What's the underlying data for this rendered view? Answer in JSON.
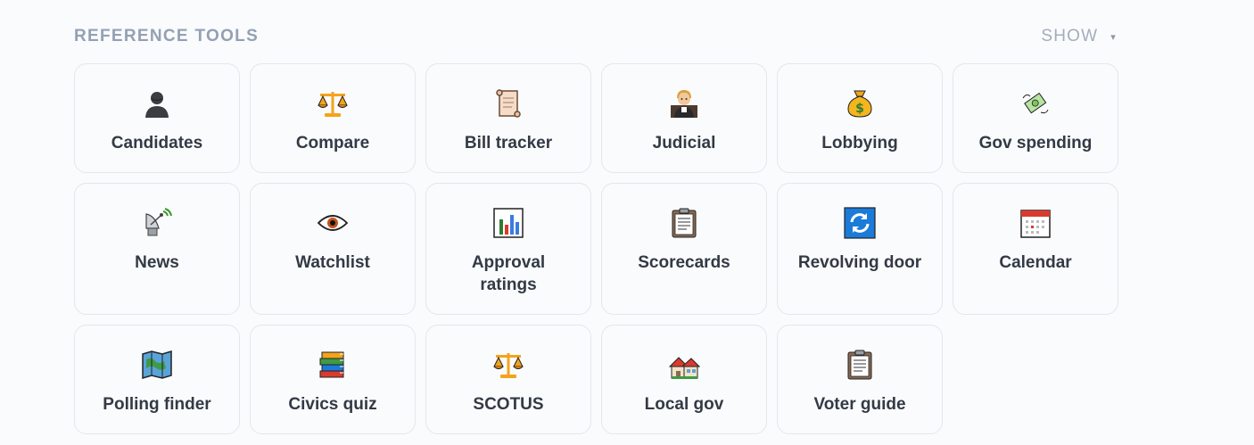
{
  "section": {
    "title": "REFERENCE TOOLS",
    "toggle_label": "SHOW",
    "toggle_caret": "▾"
  },
  "tools": [
    {
      "label": "Candidates",
      "icon": "person-silhouette-icon"
    },
    {
      "label": "Compare",
      "icon": "balance-scale-icon"
    },
    {
      "label": "Bill tracker",
      "icon": "scroll-icon"
    },
    {
      "label": "Judicial",
      "icon": "judge-icon"
    },
    {
      "label": "Lobbying",
      "icon": "money-bag-icon"
    },
    {
      "label": "Gov spending",
      "icon": "money-with-wings-icon"
    },
    {
      "label": "News",
      "icon": "satellite-antenna-icon"
    },
    {
      "label": "Watchlist",
      "icon": "eye-icon"
    },
    {
      "label": "Approval ratings",
      "icon": "bar-chart-icon"
    },
    {
      "label": "Scorecards",
      "icon": "clipboard-icon"
    },
    {
      "label": "Revolving door",
      "icon": "refresh-arrows-icon"
    },
    {
      "label": "Calendar",
      "icon": "calendar-icon"
    },
    {
      "label": "Polling finder",
      "icon": "map-icon"
    },
    {
      "label": "Civics quiz",
      "icon": "books-icon"
    },
    {
      "label": "SCOTUS",
      "icon": "balance-scale-icon"
    },
    {
      "label": "Local gov",
      "icon": "houses-icon"
    },
    {
      "label": "Voter guide",
      "icon": "clipboard-icon"
    }
  ]
}
